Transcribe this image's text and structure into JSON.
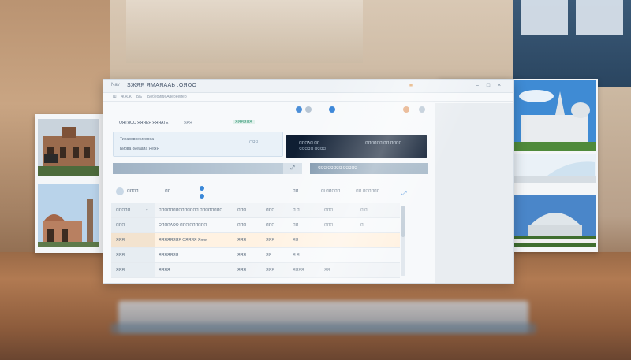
{
  "window": {
    "app_label": "Nav",
    "title": "ЅЖЯЯ ЯМАЯААЬ .ОЯОО"
  },
  "menubar": {
    "items": [
      "Ш",
      "ЖЖЖ",
      "Ыь",
      "Бобеоиии Авеоееиео"
    ]
  },
  "cards": {
    "light": {
      "header": "ОЯТЯОО ЯЯЯЕЯ ЯЯЯАТЕ",
      "header_suffix": "ЯАЯ",
      "line1": "Тиеаоовое иееооа",
      "line2": "Биова оиеааиа ЯеЯЯ",
      "badge": "ЯЯЯЯЯЯ",
      "value": "ОЯЯ"
    },
    "dark": {
      "line1": "ЯЯЯАЯ ЯЯ",
      "line2": "ЯЯЯЯЯ ЯЯЯЯ",
      "line3": "ЯЯЯЯЯЯ ЯЯ ЯЯЯЯ"
    }
  },
  "bars": {
    "mid_icon": "⤢",
    "right_label": "ЯЯЯ ЯЯЯЯЯ ЯЯЯЯЯ"
  },
  "table": {
    "headers": [
      "ЯЯЯЯ",
      "ЯЯ",
      "ЯЯ",
      "Яl ЯЯЯЯЯ",
      "ЯЯ ЯЯЯЯЯЯ"
    ],
    "rows": [
      {
        "side": "ЯЯЯЯЯ",
        "name": "ЯЯЯЯЯЯЯЯЯЯЯЯЯЯ ЯЯЯЯЯЯЯЯ",
        "c1": "ЯЯЯ",
        "c2": "ЯЯЯ",
        "c3": "Я Я",
        "c4": "ЯЯЯ",
        "c5": "Я Я"
      },
      {
        "side": "ЯЯЯ",
        "name": "ОЯЯЯАОО ЯЯЯ ЯЯЯЯЯЯ",
        "c1": "ЯЯЯ",
        "c2": "ЯЯЯ",
        "c3": "ЯЯ",
        "c4": "ЯЯЯ",
        "c5": "Я"
      },
      {
        "side": "ЯЯЯ",
        "name": "ЯЯЯЯЯЯЯЯ ОЯЯЯЯ Яяяя",
        "c1": "ЯЯЯ",
        "c2": "ЯЯЯ",
        "c3": "ЯЯ",
        "c4": "",
        "c5": ""
      },
      {
        "side": "ЯЯЯ",
        "name": "ЯЯЯЯЯЯЯ",
        "c1": "ЯЯЯ",
        "c2": "ЯЯ",
        "c3": "Я Я",
        "c4": "",
        "c5": ""
      },
      {
        "side": "ЯЯЯ",
        "name": "ЯЯЯЯ",
        "c1": "ЯЯЯ",
        "c2": "ЯЯЯ",
        "c3": "ЯЯЯЯ",
        "c4": "ЯЯ",
        "c5": ""
      }
    ]
  },
  "colors": {
    "accent": "#2f7fd6",
    "dark_card": "#0f1e33",
    "selected_row": "#fff2e2"
  },
  "icons": [
    "minimize-icon",
    "maximize-icon",
    "close-icon",
    "globe-icon",
    "info-icon",
    "expand-icon"
  ]
}
